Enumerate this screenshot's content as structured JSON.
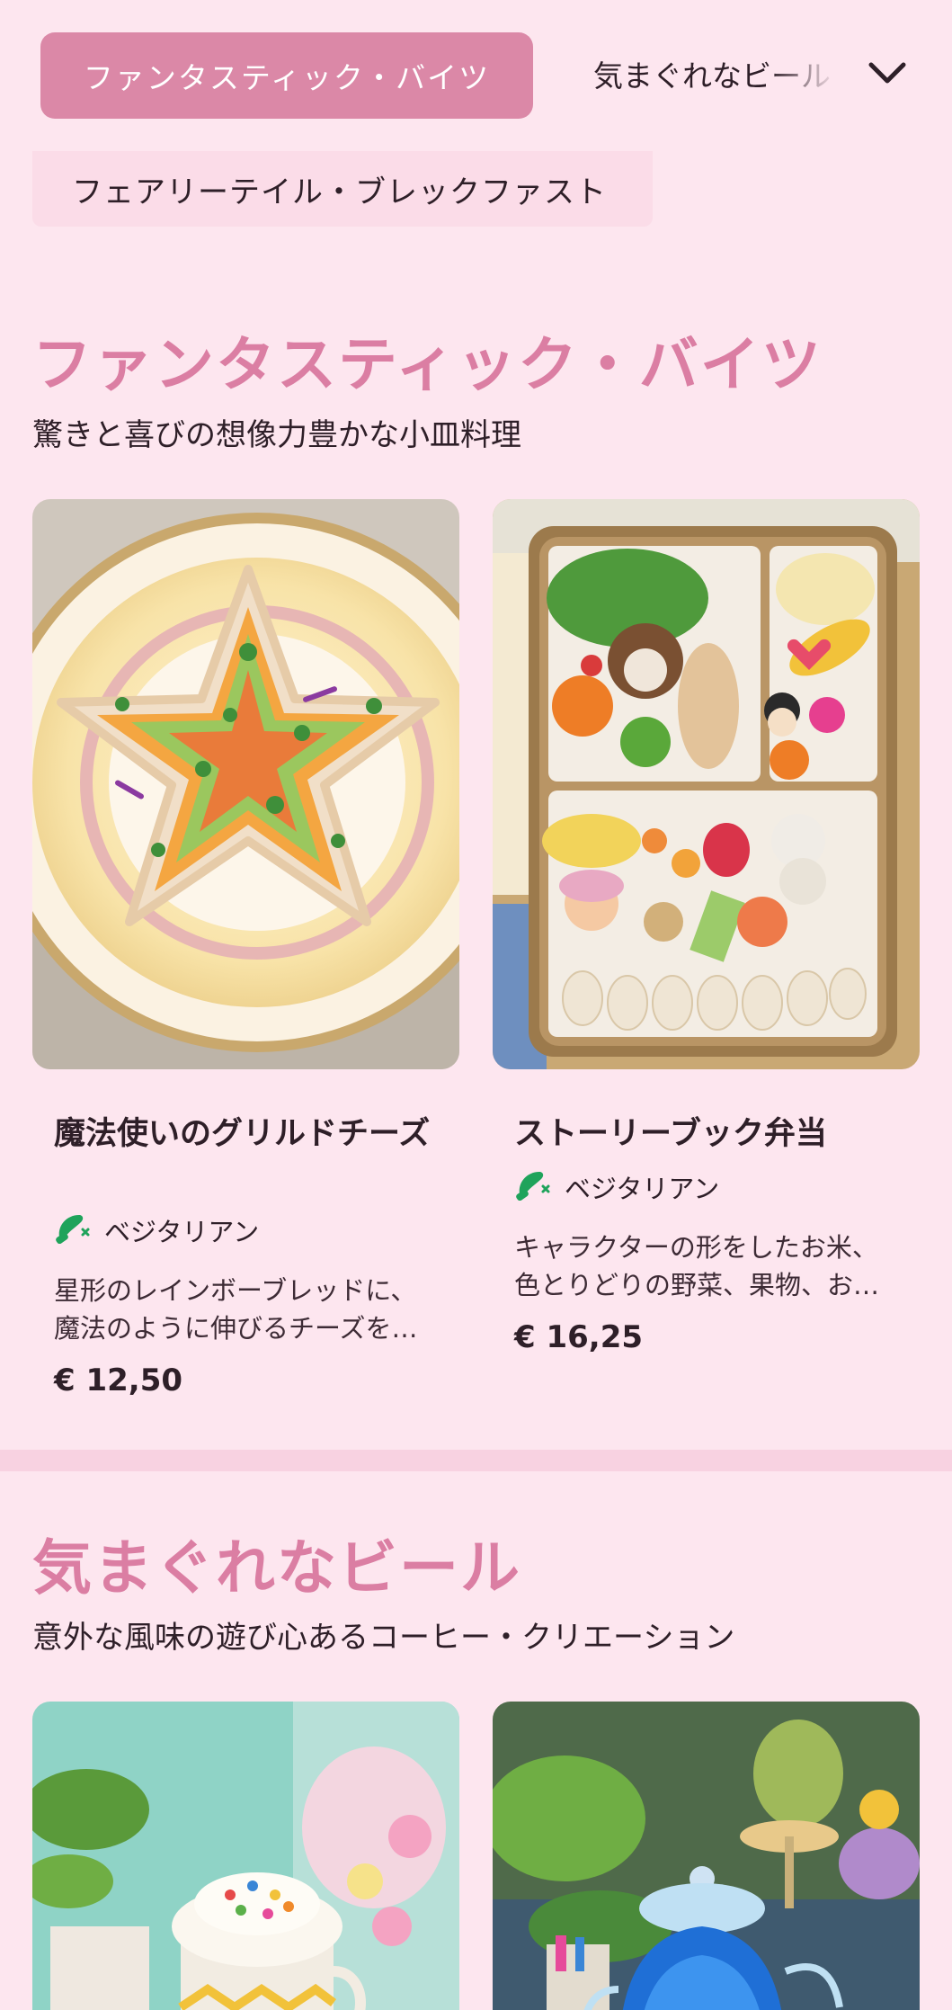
{
  "categories": {
    "active": "ファンタスティック・バイツ",
    "next": "気まぐれなビール",
    "second": "フェアリーテイル・ブレックファスト"
  },
  "sections": [
    {
      "title": "ファンタスティック・バイツ",
      "description": "驚きと喜びの想像力豊かな小皿料理",
      "items": [
        {
          "name": "魔法使いのグリルドチーズ",
          "tag": "ベジタリアン",
          "description": "星形のレインボーブレッドに、魔法のように伸びるチーズを…",
          "price": "€ 12,50"
        },
        {
          "name": "ストーリーブック弁当",
          "tag": "ベジタリアン",
          "description": "キャラクターの形をしたお米、色とりどりの野菜、果物、お…",
          "price": "€ 16,25"
        }
      ]
    },
    {
      "title": "気まぐれなビール",
      "description": "意外な風味の遊び心あるコーヒー・クリエーション"
    }
  ],
  "colors": {
    "background": "#fde6ef",
    "accent": "#db88a7",
    "heading": "#db7ea3",
    "veg_green": "#1fa35b"
  },
  "icons": {
    "chevron": "chevron-down-icon",
    "veg": "vegetarian-icon"
  }
}
